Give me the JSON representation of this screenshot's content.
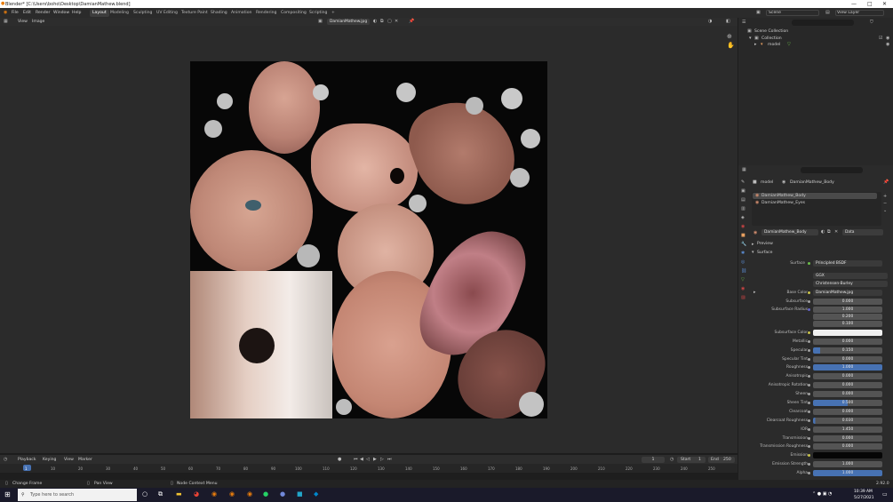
{
  "titlebar": {
    "title": "Blender* [C:\\Users\\boho\\Desktop\\DamianMathew.blend]",
    "minimize": "—",
    "maximize": "□",
    "close": "✕"
  },
  "menubar": {
    "items": [
      "File",
      "Edit",
      "Render",
      "Window",
      "Help"
    ],
    "workspaces": [
      "Layout",
      "Modeling",
      "Sculpting",
      "UV Editing",
      "Texture Paint",
      "Shading",
      "Animation",
      "Rendering",
      "Compositing",
      "Scripting"
    ],
    "active_workspace": "Layout",
    "add_tab": "+",
    "scene_label": "Scene",
    "view_layer_label": "View Layer"
  },
  "image_editor": {
    "menus": [
      "View",
      "Image"
    ],
    "image_name": "DamianMathew.jpg"
  },
  "timeline": {
    "menus": [
      "Playback",
      "Keying",
      "View",
      "Marker"
    ],
    "current_frame": "1",
    "start_label": "Start",
    "start": "1",
    "end_label": "End",
    "end": "250",
    "ticks": [
      "1",
      "10",
      "20",
      "30",
      "40",
      "50",
      "60",
      "70",
      "80",
      "90",
      "100",
      "110",
      "120",
      "130",
      "140",
      "150",
      "160",
      "170",
      "180",
      "190",
      "200",
      "210",
      "220",
      "230",
      "240",
      "250"
    ]
  },
  "statusbar": {
    "left": "Change Frame",
    "middle": "Pan View",
    "right": "Node Context Menu",
    "version": "2.92.0"
  },
  "outliner": {
    "root": "Scene Collection",
    "collection": "Collection",
    "object": "model"
  },
  "properties": {
    "object": "model",
    "material_link": "DamianMathew_Body",
    "slots": [
      "DamianMathew_Body",
      "DamianMathew_Eyes"
    ],
    "material_name": "DamianMathew_Body",
    "data_label": "Data",
    "preview": "Preview",
    "surface_panel": "Surface",
    "surface_label": "Surface",
    "surface_value": "Principled BSDF",
    "distribution": "GGX",
    "subsurface_method": "Christensen-Burley",
    "rows": [
      {
        "label": "Base Color",
        "value": "DamianMathew.jpg"
      },
      {
        "label": "Subsurface",
        "value": "0.000"
      },
      {
        "label": "Subsurface Radius",
        "value": "1.000"
      },
      {
        "label": "",
        "value": "0.200"
      },
      {
        "label": "",
        "value": "0.100"
      },
      {
        "label": "Subsurface Color",
        "value": ""
      },
      {
        "label": "Metallic",
        "value": "0.000"
      },
      {
        "label": "Specular",
        "value": "0.150"
      },
      {
        "label": "Specular Tint",
        "value": "0.000"
      },
      {
        "label": "Roughness",
        "value": "1.000"
      },
      {
        "label": "Anisotropic",
        "value": "0.000"
      },
      {
        "label": "Anisotropic Rotation",
        "value": "0.000"
      },
      {
        "label": "Sheen",
        "value": "0.000"
      },
      {
        "label": "Sheen Tint",
        "value": "0.500"
      },
      {
        "label": "Clearcoat",
        "value": "0.000"
      },
      {
        "label": "Clearcoat Roughness",
        "value": "0.030"
      },
      {
        "label": "IOR",
        "value": "1.450"
      },
      {
        "label": "Transmission",
        "value": "0.000"
      },
      {
        "label": "Transmission Roughness",
        "value": "0.000"
      },
      {
        "label": "Emission",
        "value": ""
      },
      {
        "label": "Emission Strength",
        "value": "1.000"
      },
      {
        "label": "Alpha",
        "value": "1.000"
      }
    ],
    "last_row": "Normal",
    "last_value": "Default"
  },
  "taskbar": {
    "search_placeholder": "Type here to search",
    "time": "10:39 AM",
    "date": "5/27/2021"
  }
}
